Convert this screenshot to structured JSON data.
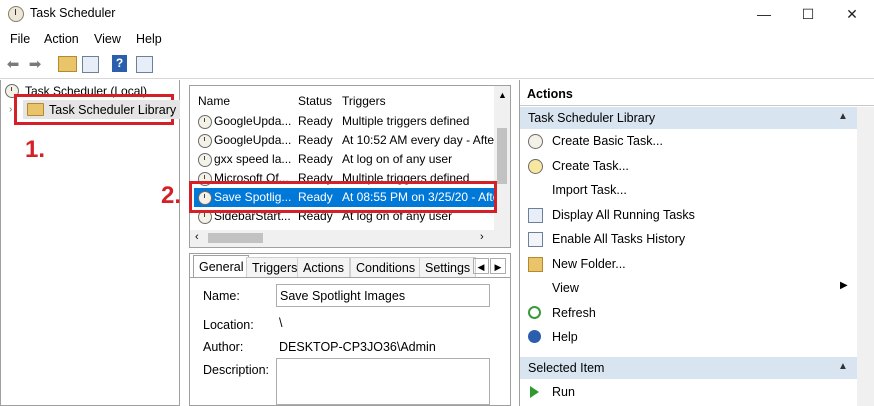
{
  "window": {
    "title": "Task Scheduler",
    "minimize_glyph": "—",
    "maximize_glyph": "☐",
    "close_glyph": "✕"
  },
  "menu": [
    "File",
    "Action",
    "View",
    "Help"
  ],
  "toolbar": {
    "icons": [
      "back-arrow-icon",
      "forward-arrow-icon",
      "up-folder-icon",
      "show-hide-console-tree-icon",
      "help-icon",
      "show-hide-action-pane-icon"
    ]
  },
  "tree": {
    "root": "Task Scheduler (Local)",
    "library": "Task Scheduler Library"
  },
  "annotations": {
    "step1": "1.",
    "step2": "2."
  },
  "task_list": {
    "columns": [
      "Name",
      "Status",
      "Triggers"
    ],
    "rows": [
      {
        "name": "GoogleUpda...",
        "status": "Ready",
        "triggers": "Multiple triggers defined"
      },
      {
        "name": "GoogleUpda...",
        "status": "Ready",
        "triggers": "At 10:52 AM every day - Afte"
      },
      {
        "name": "gxx speed la...",
        "status": "Ready",
        "triggers": "At log on of any user"
      },
      {
        "name": "Microsoft Of...",
        "status": "Ready",
        "triggers": "Multiple triggers defined"
      },
      {
        "name": "Save Spotlig...",
        "status": "Ready",
        "triggers": "At 08:55 PM on 3/25/20 - Afte"
      },
      {
        "name": "SidebarStart...",
        "status": "Ready",
        "triggers": "At log on of any user"
      }
    ],
    "selected_index": 4
  },
  "details": {
    "tabs": [
      "General",
      "Triggers",
      "Actions",
      "Conditions",
      "Settings"
    ],
    "active_tab": "General",
    "fields": {
      "name_label": "Name:",
      "name_value": "Save Spotlight Images",
      "location_label": "Location:",
      "location_value": "\\",
      "author_label": "Author:",
      "author_value": "DESKTOP-CP3JO36\\Admin",
      "description_label": "Description:"
    }
  },
  "actions": {
    "header": "Actions",
    "section1": "Task Scheduler Library",
    "items": [
      {
        "label": "Create Basic Task...",
        "icon": "create-basic-task-icon"
      },
      {
        "label": "Create Task...",
        "icon": "create-task-icon"
      },
      {
        "label": "Import Task...",
        "icon": ""
      },
      {
        "label": "Display All Running Tasks",
        "icon": "running-tasks-icon"
      },
      {
        "label": "Enable All Tasks History",
        "icon": "history-icon"
      },
      {
        "label": "New Folder...",
        "icon": "new-folder-icon"
      },
      {
        "label": "View",
        "icon": "",
        "submenu": true
      },
      {
        "label": "Refresh",
        "icon": "refresh-icon"
      },
      {
        "label": "Help",
        "icon": "help-icon"
      }
    ],
    "section2": "Selected Item",
    "selected_items": [
      {
        "label": "Run",
        "icon": "run-icon"
      }
    ]
  },
  "colors": {
    "selection": "#0078d7",
    "annotation": "#d42027",
    "section_header": "#d9e4f1"
  }
}
